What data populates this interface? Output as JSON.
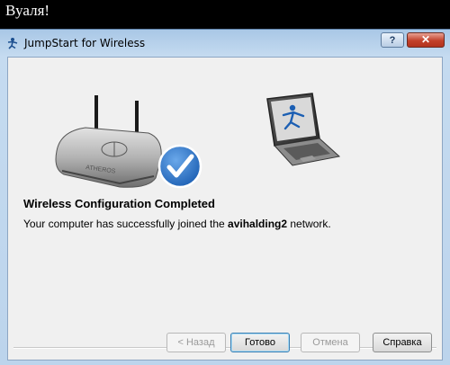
{
  "caption": "Вуаля!",
  "window": {
    "title": "JumpStart for Wireless",
    "help_label": "?",
    "close_label": "✕"
  },
  "content": {
    "heading": "Wireless Configuration Completed",
    "message_before": "Your computer has successfully joined the ",
    "network_name": "avihalding2",
    "message_after": " network.",
    "router_brand": "ATHEROS"
  },
  "buttons": {
    "back": "< Назад",
    "done": "Готово",
    "cancel": "Отмена",
    "help": "Справка"
  },
  "colors": {
    "check_blue": "#1c5fb3",
    "title_bar": "#bcd4ec",
    "close_red": "#c2402a"
  },
  "icons": [
    "jumpstart-icon",
    "router-icon",
    "checkmark-icon",
    "laptop-icon"
  ]
}
